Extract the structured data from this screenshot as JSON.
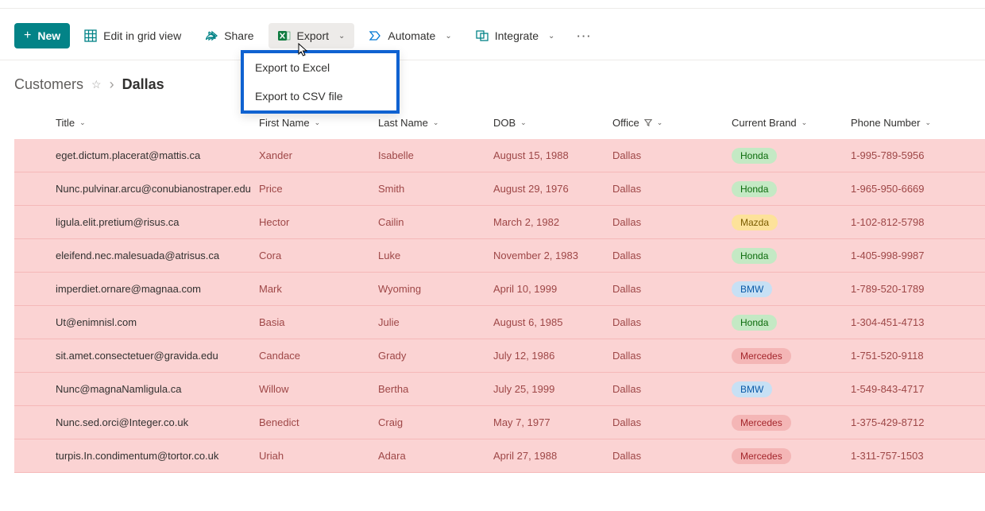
{
  "toolbar": {
    "new_label": "New",
    "edit_grid_label": "Edit in grid view",
    "share_label": "Share",
    "export_label": "Export",
    "automate_label": "Automate",
    "integrate_label": "Integrate"
  },
  "export_menu": {
    "excel": "Export to Excel",
    "csv": "Export to CSV file"
  },
  "breadcrumb": {
    "list": "Customers",
    "current": "Dallas"
  },
  "columns": {
    "title": "Title",
    "first_name": "First Name",
    "last_name": "Last Name",
    "dob": "DOB",
    "office": "Office",
    "brand": "Current Brand",
    "phone": "Phone Number"
  },
  "rows": [
    {
      "title": "eget.dictum.placerat@mattis.ca",
      "first": "Xander",
      "last": "Isabelle",
      "dob": "August 15, 1988",
      "office": "Dallas",
      "brand": "Honda",
      "phone": "1-995-789-5956"
    },
    {
      "title": "Nunc.pulvinar.arcu@conubianostraper.edu",
      "first": "Price",
      "last": "Smith",
      "dob": "August 29, 1976",
      "office": "Dallas",
      "brand": "Honda",
      "phone": "1-965-950-6669"
    },
    {
      "title": "ligula.elit.pretium@risus.ca",
      "first": "Hector",
      "last": "Cailin",
      "dob": "March 2, 1982",
      "office": "Dallas",
      "brand": "Mazda",
      "phone": "1-102-812-5798"
    },
    {
      "title": "eleifend.nec.malesuada@atrisus.ca",
      "first": "Cora",
      "last": "Luke",
      "dob": "November 2, 1983",
      "office": "Dallas",
      "brand": "Honda",
      "phone": "1-405-998-9987"
    },
    {
      "title": "imperdiet.ornare@magnaa.com",
      "first": "Mark",
      "last": "Wyoming",
      "dob": "April 10, 1999",
      "office": "Dallas",
      "brand": "BMW",
      "phone": "1-789-520-1789"
    },
    {
      "title": "Ut@enimnisl.com",
      "first": "Basia",
      "last": "Julie",
      "dob": "August 6, 1985",
      "office": "Dallas",
      "brand": "Honda",
      "phone": "1-304-451-4713"
    },
    {
      "title": "sit.amet.consectetuer@gravida.edu",
      "first": "Candace",
      "last": "Grady",
      "dob": "July 12, 1986",
      "office": "Dallas",
      "brand": "Mercedes",
      "phone": "1-751-520-9118"
    },
    {
      "title": "Nunc@magnaNamligula.ca",
      "first": "Willow",
      "last": "Bertha",
      "dob": "July 25, 1999",
      "office": "Dallas",
      "brand": "BMW",
      "phone": "1-549-843-4717"
    },
    {
      "title": "Nunc.sed.orci@Integer.co.uk",
      "first": "Benedict",
      "last": "Craig",
      "dob": "May 7, 1977",
      "office": "Dallas",
      "brand": "Mercedes",
      "phone": "1-375-429-8712"
    },
    {
      "title": "turpis.In.condimentum@tortor.co.uk",
      "first": "Uriah",
      "last": "Adara",
      "dob": "April 27, 1988",
      "office": "Dallas",
      "brand": "Mercedes",
      "phone": "1-311-757-1503"
    }
  ],
  "brand_classes": {
    "Honda": "pill-honda",
    "Mazda": "pill-mazda",
    "BMW": "pill-bmw",
    "Mercedes": "pill-mercedes"
  }
}
